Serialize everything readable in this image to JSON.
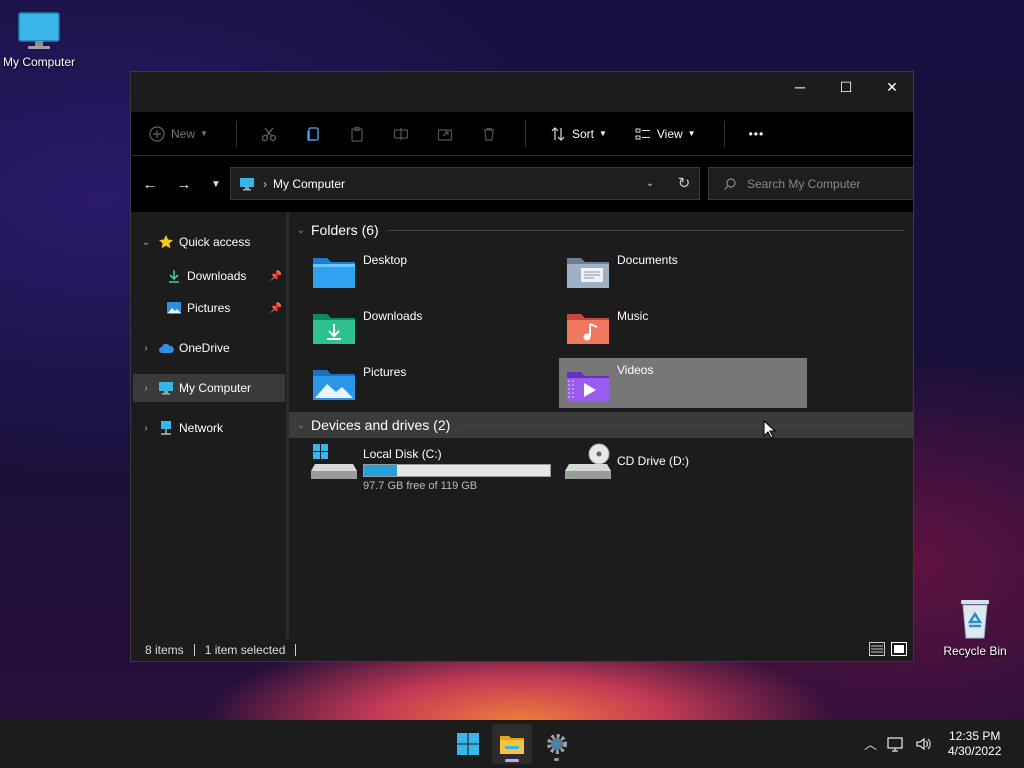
{
  "desktop": {
    "icons": [
      {
        "label": "My Computer"
      },
      {
        "label": "Recycle Bin"
      }
    ]
  },
  "window": {
    "title_controls": {
      "minimize": "─",
      "maximize": "☐",
      "close": "✕"
    },
    "toolbar": {
      "new_label": "New",
      "sort_label": "Sort",
      "view_label": "View",
      "more_label": "•••"
    },
    "address": {
      "path": "My Computer",
      "search_placeholder": "Search My Computer"
    },
    "sidebar": {
      "items": [
        {
          "label": "Quick access",
          "icon": "star-icon"
        },
        {
          "label": "Downloads",
          "icon": "download-icon",
          "pinned": true
        },
        {
          "label": "Pictures",
          "icon": "pictures-icon",
          "pinned": true
        },
        {
          "label": "OneDrive",
          "icon": "cloud-icon"
        },
        {
          "label": "My Computer",
          "icon": "computer-icon",
          "selected": true
        },
        {
          "label": "Network",
          "icon": "network-icon"
        }
      ]
    },
    "content": {
      "folders_heading": "Folders (6)",
      "folders": [
        {
          "name": "Desktop",
          "icon": "desktop-folder-icon"
        },
        {
          "name": "Documents",
          "icon": "documents-folder-icon"
        },
        {
          "name": "Downloads",
          "icon": "downloads-folder-icon"
        },
        {
          "name": "Music",
          "icon": "music-folder-icon"
        },
        {
          "name": "Pictures",
          "icon": "pictures-folder-icon"
        },
        {
          "name": "Videos",
          "icon": "videos-folder-icon",
          "selected": true
        }
      ],
      "drives_heading": "Devices and drives (2)",
      "drives": [
        {
          "name": "Local Disk (C:)",
          "free_text": "97.7 GB free of 119 GB",
          "used_fraction": 0.18
        },
        {
          "name": "CD Drive (D:)"
        }
      ]
    },
    "status": {
      "items_count": "8 items",
      "selection": "1 item selected"
    }
  },
  "taskbar": {
    "apps": [
      {
        "name": "start-icon"
      },
      {
        "name": "file-explorer-icon",
        "active": true
      },
      {
        "name": "settings-icon"
      }
    ],
    "clock": {
      "time": "12:35 PM",
      "date": "4/30/2022"
    }
  }
}
